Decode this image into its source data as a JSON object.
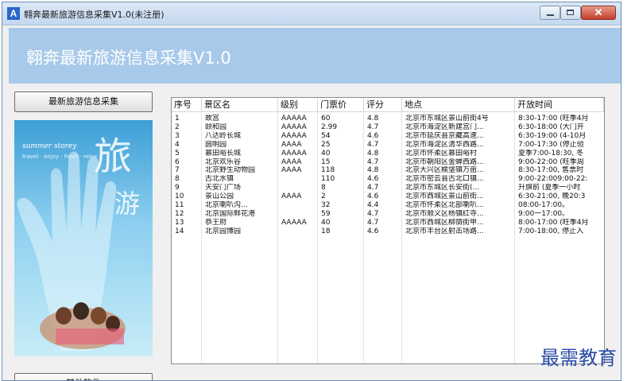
{
  "window": {
    "title": "翱奔最新旅游信息采集V1.0(未注册)",
    "icon": "app-icon"
  },
  "banner": {
    "title": "翱奔最新旅游信息采集V1.0"
  },
  "sidebar": {
    "collect_button": "最新旅游信息采集",
    "other_button": "其他软件",
    "poster": {
      "big1": "旅",
      "big2": "游",
      "small1": "summer storey",
      "small2": "travel · enjoy · fresh · relax"
    }
  },
  "table": {
    "columns": [
      "序号",
      "景区名",
      "级别",
      "门票价",
      "评分",
      "地点",
      "开放时间"
    ],
    "rows": [
      [
        "1",
        "故宫",
        "AAAAA",
        "60",
        "4.8",
        "北京市东城区景山前街4号",
        "8:30-17:00 (旺季4月"
      ],
      [
        "2",
        "颐和园",
        "AAAAA",
        "2.99",
        "4.7",
        "北京市海淀区新建宫门...",
        "6:30-18:00 (大门开"
      ],
      [
        "3",
        "八达岭长城",
        "AAAAA",
        "54",
        "4.6",
        "北京市延庆县京藏高速...",
        "6:30-19:00 (4-10月"
      ],
      [
        "4",
        "圆明园",
        "AAAA",
        "25",
        "4.7",
        "北京市海淀区清华西路...",
        "7:00-17:30 (停止验"
      ],
      [
        "5",
        "慕田峪长城",
        "AAAAA",
        "40",
        "4.8",
        "北京市怀柔区慕田峪村",
        "夏季7:00-18:30, 冬"
      ],
      [
        "6",
        "北京欢乐谷",
        "AAAA",
        "15",
        "4.7",
        "北京市朝阳区金蝉西路...",
        "9:00-22:00 (旺季周"
      ],
      [
        "7",
        "北京野生动物园",
        "AAAA",
        "118",
        "4.8",
        "北京大兴区榆垡镇万亩...",
        "8:30-17:00, 售票时"
      ],
      [
        "8",
        "古北水镇",
        "",
        "110",
        "4.6",
        "北京市密云县古北口镇...",
        "9:00-22:009:00-22:"
      ],
      [
        "9",
        "天安门广场",
        "",
        "8",
        "4.7",
        "北京市东城区长安街(...",
        "升旗前 (夏季一小时"
      ],
      [
        "10",
        "景山公园",
        "AAAA",
        "2",
        "4.6",
        "北京市西城区景山前街...",
        "6:30-21:00, 晚20:3"
      ],
      [
        "11",
        "北京喇叭沟...",
        "",
        "32",
        "4.4",
        "北京市怀柔区北部喇叭...",
        "08:00-17:00。"
      ],
      [
        "12",
        "北京国际鲜花港",
        "",
        "59",
        "4.7",
        "北京市顺义区杨镇红寺...",
        "9:00一17:00。"
      ],
      [
        "13",
        "恭王府",
        "AAAAA",
        "40",
        "4.7",
        "北京市西城区柳荫街甲...",
        "8:00-17:00 (旺季4月"
      ],
      [
        "14",
        "北京园博园",
        "",
        "18",
        "4.6",
        "北京市丰台区射击场路...",
        "7:00-18:00, 停止入"
      ]
    ]
  },
  "watermark": "最需教育"
}
